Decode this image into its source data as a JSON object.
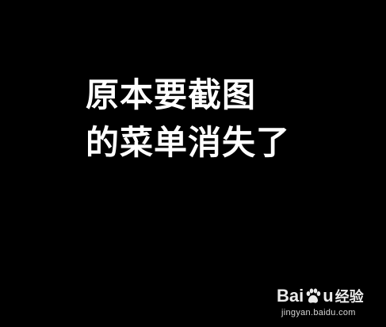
{
  "caption": {
    "line1": "原本要截图",
    "line2": "的菜单消失了"
  },
  "watermark": {
    "brand_left": "Bai",
    "brand_right": "u",
    "label": "经验",
    "url": "jingyan.baidu.com",
    "icon": "paw-icon"
  },
  "colors": {
    "background": "#000000",
    "text": "#ffffff"
  }
}
